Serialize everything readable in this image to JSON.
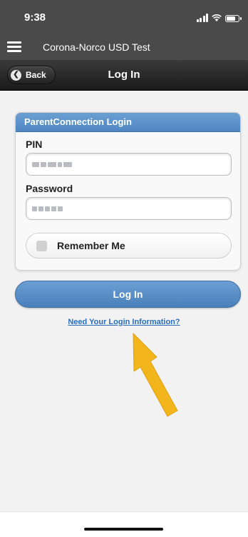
{
  "status": {
    "time": "9:38"
  },
  "header": {
    "app_title": "Corona-Norco USD Test",
    "menu_icon": "hamburger-icon"
  },
  "nav": {
    "back_label": "Back",
    "title": "Log In"
  },
  "form": {
    "card_title": "ParentConnection Login",
    "pin_label": "PIN",
    "password_label": "Password",
    "remember_label": "Remember Me",
    "remember_checked": false
  },
  "actions": {
    "login_label": "Log In",
    "help_link": "Need Your Login Information?"
  },
  "colors": {
    "accent": "#4f87c2",
    "header_bg": "#4a4a4a",
    "link": "#2a6ebb",
    "arrow": "#f2b51c"
  }
}
